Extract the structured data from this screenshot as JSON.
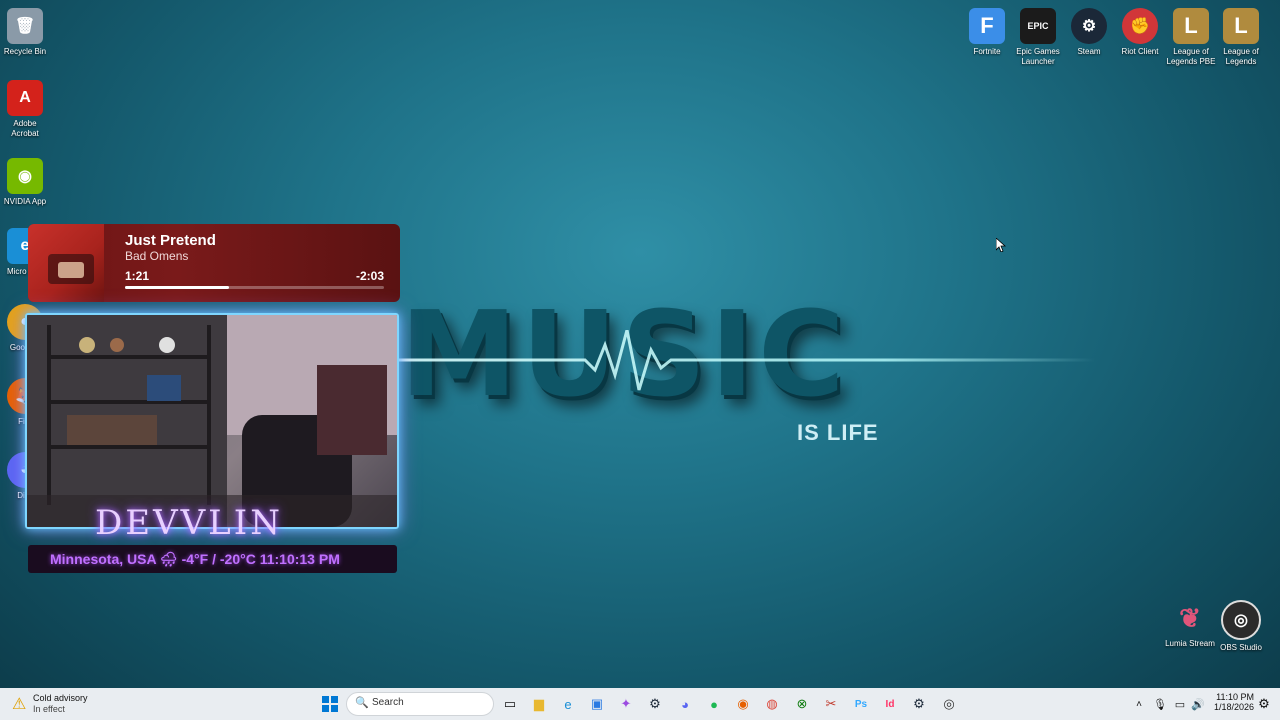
{
  "desktop_left_icons": [
    {
      "label": "Recycle Bin",
      "icon": "recycle-bin-icon",
      "color": "#9aa7b3"
    },
    {
      "label": "Adobe Acrobat",
      "icon": "acrobat-icon",
      "color": "#d4221b"
    },
    {
      "label": "NVIDIA App",
      "icon": "nvidia-icon",
      "color": "#76b900"
    },
    {
      "label": "Micro Edg",
      "icon": "edge-icon",
      "color": "#1a8fd6"
    },
    {
      "label": "Goo Chr",
      "icon": "chrome-icon",
      "color": "#e3a21a"
    },
    {
      "label": "Fire",
      "icon": "firefox-icon",
      "color": "#e66000"
    },
    {
      "label": "Disc",
      "icon": "discord-icon",
      "color": "#5865f2"
    }
  ],
  "desktop_right_icons": [
    {
      "label": "Fortnite",
      "icon": "fortnite-icon",
      "color": "#3b8ee8",
      "glyph": "F"
    },
    {
      "label": "Epic Games Launcher",
      "icon": "epic-games-icon",
      "color": "#1b1b1b",
      "glyph": "EPIC"
    },
    {
      "label": "Steam",
      "icon": "steam-icon",
      "color": "#1b2838",
      "glyph": "⚙"
    },
    {
      "label": "Riot Client",
      "icon": "riot-icon",
      "color": "#d13639",
      "glyph": "✊"
    },
    {
      "label": "League of Legends PBE",
      "icon": "lol-pbe-icon",
      "color": "#b08b3e",
      "glyph": "L"
    },
    {
      "label": "League of Legends",
      "icon": "lol-icon",
      "color": "#b08b3e",
      "glyph": "L"
    }
  ],
  "desktop_bottom_icons": [
    {
      "label": "Lumia Stream",
      "icon": "lumia-icon",
      "color": "#e0557a"
    },
    {
      "label": "OBS Studio",
      "icon": "obs-icon",
      "color": "#2b2b2b"
    }
  ],
  "wallpaper": {
    "word": "MUSIC",
    "tagline": "IS LIFE"
  },
  "now_playing": {
    "title": "Just Pretend",
    "artist": "Bad Omens",
    "elapsed": "1:21",
    "remaining": "-2:03",
    "progress": 0.4
  },
  "stream_overlay": {
    "name": "DEVVLIN",
    "weather": "Minnesota, USA 🌧 -4°F / -20°C  11:10:13 PM"
  },
  "taskbar": {
    "weather_title": "Cold advisory",
    "weather_sub": "In effect",
    "search_placeholder": "Search",
    "time": "11:10 PM",
    "date": "1/18/2026",
    "apps": [
      "start-icon",
      "task-view-icon",
      "file-explorer-icon",
      "edge-icon",
      "store-icon",
      "copilot-icon",
      "steam-icon",
      "discord-icon",
      "spotify-icon",
      "firefox-icon",
      "chrome-icon",
      "xbox-icon",
      "snip-icon",
      "photoshop-icon",
      "indesign-icon",
      "steam-alt-icon",
      "obs-icon"
    ]
  }
}
